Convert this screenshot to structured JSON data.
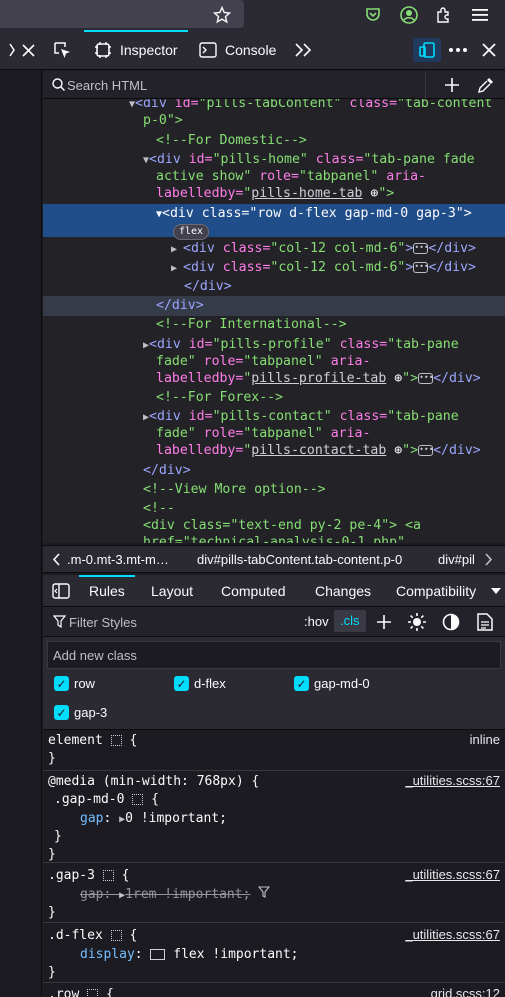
{
  "devtools": {
    "tabs": [
      {
        "label": "Inspector"
      },
      {
        "label": "Console"
      }
    ]
  },
  "search": {
    "placeholder": "Search HTML"
  },
  "markup": {
    "l1": [
      "<div ",
      "id=",
      "\"pills-tabContent\"",
      " class=",
      "\"tab-content"
    ],
    "l2": "p-0\">",
    "l3": "<!--For Domestic-->",
    "l4a": [
      "<div ",
      "id=",
      "\"pills-home\"",
      " class=",
      "\"tab-pane fade"
    ],
    "l4b": [
      "active show\"",
      " role=",
      "\"tabpanel\"",
      " aria-"
    ],
    "l4c": [
      "labelledby=",
      "\"",
      "pills-home-tab",
      "\">"
    ],
    "l5": [
      "<div ",
      "class=",
      "\"row d-flex gap-md-0 gap-3\"",
      ">"
    ],
    "badge": "flex",
    "l6": [
      "<div ",
      "class=",
      "\"col-12 col-md-6\"",
      ">",
      "</div>"
    ],
    "l7": [
      "<div ",
      "class=",
      "\"col-12 col-md-6\"",
      ">",
      "</div>"
    ],
    "l8": "</div>",
    "l9": "</div>",
    "l10": "<!--For International-->",
    "l11a": [
      "<div ",
      "id=",
      "\"pills-profile\"",
      " class=",
      "\"tab-pane"
    ],
    "l11b": [
      "fade\"",
      " role=",
      "\"tabpanel\"",
      " aria-"
    ],
    "l11c": [
      "labelledby=",
      "\"",
      "pills-profile-tab",
      "</div>"
    ],
    "l12": "<!--For Forex-->",
    "l13a": [
      "<div ",
      "id=",
      "\"pills-contact\"",
      " class=",
      "\"tab-pane"
    ],
    "l13b": [
      "fade\"",
      " role=",
      "\"tabpanel\"",
      " aria-"
    ],
    "l13c": [
      "labelledby=",
      "\"",
      "pills-contact-tab",
      "\">",
      "</div>"
    ],
    "l14": "</div>",
    "l15": "<!--View More option-->",
    "l16": "<!--",
    "l17": [
      "<div ",
      "class=",
      "\"text-end py-2 pe-4\"",
      "> <a"
    ],
    "l18": "href=\"technical-analysis-0-1.php\""
  },
  "breadcrumbs": [
    {
      "label": ".m-0.mt-3.mt-m…"
    },
    {
      "label": "div#pills-tabContent.tab-content.p-0"
    },
    {
      "label": "div#pil"
    }
  ],
  "rules_tabs": [
    {
      "label": "Rules"
    },
    {
      "label": "Layout"
    },
    {
      "label": "Computed"
    },
    {
      "label": "Changes"
    },
    {
      "label": "Compatibility"
    }
  ],
  "filter": {
    "placeholder": "Filter Styles",
    "hov": ":hov",
    "cls": ".cls"
  },
  "class_panel": {
    "placeholder": "Add new class",
    "classes": [
      {
        "name": "row",
        "checked": true
      },
      {
        "name": "d-flex",
        "checked": true
      },
      {
        "name": "gap-md-0",
        "checked": true
      },
      {
        "name": "gap-3",
        "checked": true
      }
    ]
  },
  "rules": {
    "element": {
      "selector": "element",
      "open": "{",
      "close": "}",
      "source": "inline"
    },
    "media": {
      "query": "@media (min-width: 768px) {",
      "selector": ".gap-md-0",
      "open": "{",
      "prop": "gap",
      "value": "0 !important;",
      "close_inner": "}",
      "close_outer": "}",
      "source": "_utilities.scss:67"
    },
    "gap3": {
      "selector": ".gap-3",
      "open": "{",
      "prop": "gap",
      "value": "1rem !important;",
      "close": "}",
      "source": "_utilities.scss:67"
    },
    "dflex": {
      "selector": ".d-flex",
      "open": "{",
      "prop": "display",
      "value": "flex !important;",
      "close": "}",
      "source": "_utilities.scss:67"
    },
    "row": {
      "selector": ".row",
      "open": "{",
      "source": "grid.scss:12"
    }
  }
}
